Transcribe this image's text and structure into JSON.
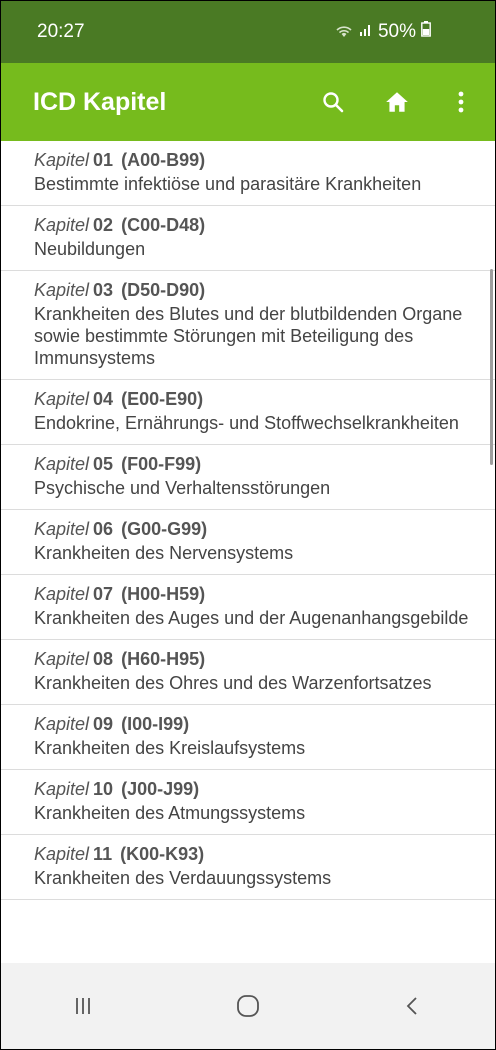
{
  "status": {
    "time": "20:27",
    "battery": "50%"
  },
  "appbar": {
    "title": "ICD Kapitel"
  },
  "chapters": [
    {
      "label": "Kapitel",
      "number": "01",
      "range": "(A00-B99)",
      "desc": "Bestimmte infektiöse und parasitäre Krankheiten"
    },
    {
      "label": "Kapitel",
      "number": "02",
      "range": "(C00-D48)",
      "desc": "Neubildungen"
    },
    {
      "label": "Kapitel",
      "number": "03",
      "range": "(D50-D90)",
      "desc": "Krankheiten des Blutes und der blutbildenden Organe sowie bestimmte Störungen mit Beteiligung des Immunsystems"
    },
    {
      "label": "Kapitel",
      "number": "04",
      "range": "(E00-E90)",
      "desc": "Endokrine, Ernährungs- und Stoffwechselkrankheiten"
    },
    {
      "label": "Kapitel",
      "number": "05",
      "range": "(F00-F99)",
      "desc": "Psychische und Verhaltensstörungen"
    },
    {
      "label": "Kapitel",
      "number": "06",
      "range": "(G00-G99)",
      "desc": "Krankheiten des Nervensystems"
    },
    {
      "label": "Kapitel",
      "number": "07",
      "range": "(H00-H59)",
      "desc": "Krankheiten des Auges und der Augenanhangsgebilde"
    },
    {
      "label": "Kapitel",
      "number": "08",
      "range": "(H60-H95)",
      "desc": "Krankheiten des Ohres und des Warzenfortsatzes"
    },
    {
      "label": "Kapitel",
      "number": "09",
      "range": "(I00-I99)",
      "desc": "Krankheiten des Kreislaufsystems"
    },
    {
      "label": "Kapitel",
      "number": "10",
      "range": "(J00-J99)",
      "desc": "Krankheiten des Atmungssystems"
    },
    {
      "label": "Kapitel",
      "number": "11",
      "range": "(K00-K93)",
      "desc": "Krankheiten des Verdauungssystems"
    }
  ],
  "colors": {
    "statusbar": "#4a7a24",
    "appbar": "#76bb1d",
    "navbar": "#f2f2f2"
  }
}
